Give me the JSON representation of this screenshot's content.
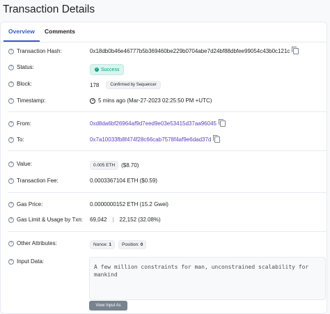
{
  "page": {
    "title": "Transaction Details"
  },
  "tabs": [
    {
      "label": "Overview"
    },
    {
      "label": "Comments"
    }
  ],
  "details": {
    "hash": {
      "label": "Transaction Hash:",
      "value": "0x18db0b46e46777b5b369460be229b0704abe7d24bf88dbfee99054c43b0c121c"
    },
    "status": {
      "label": "Status:",
      "value": "Success"
    },
    "block": {
      "label": "Block:",
      "value": "178",
      "badge": "Confirmed by Sequencer"
    },
    "timestamp": {
      "label": "Timestamp:",
      "value": "5 mins ago (Mar-27-2023 02:25:50 PM +UTC)"
    },
    "from": {
      "label": "From:",
      "value": "0xd8da6bf26964af9d7eed9e03e53415d37aa96045"
    },
    "to": {
      "label": "To:",
      "value": "0x7a10033fb8f474f28c66cab7578f4af9e6dad37d"
    },
    "value": {
      "label": "Value:",
      "amount": "0.005 ETH",
      "usd": "($8.70)"
    },
    "fee": {
      "label": "Transaction Fee:",
      "value": "0.0003367104 ETH ($0.59)"
    },
    "gas_price": {
      "label": "Gas Price:",
      "value": "0.0000000152 ETH (15.2 Gwei)"
    },
    "gas_limit": {
      "label": "Gas Limit & Usage by Txn:",
      "limit": "69,042",
      "separator": "|",
      "usage": "22,152 (32.08%)"
    },
    "other": {
      "label": "Other Attributes:",
      "nonce_label": "Nonce:",
      "nonce": "1",
      "position_label": "Position:",
      "position": "0"
    },
    "input": {
      "label": "Input Data:",
      "value": "A few million constraints for man, unconstrained scalability for mankind",
      "button": "View Input As"
    }
  },
  "colors": {
    "accent": "#3459c8",
    "link": "#5a3fc0",
    "success": "#00a186"
  },
  "icons": [
    "help-icon",
    "copy-icon",
    "clock-icon",
    "check-icon"
  ]
}
